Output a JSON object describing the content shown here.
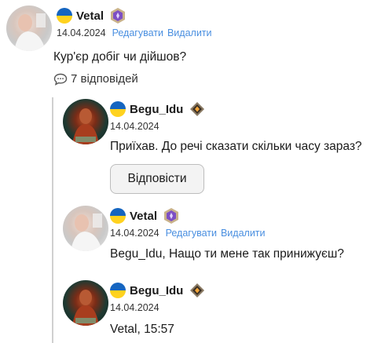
{
  "main_comment": {
    "username": "Vetal",
    "date": "14.04.2024",
    "edit_label": "Редагувати",
    "delete_label": "Видалити",
    "text": "Кур'єр добіг чи дійшов?",
    "replies_count": "7 відповідей"
  },
  "replies": [
    {
      "username": "Begu_Idu",
      "date": "14.04.2024",
      "text": "Приїхав. До речі сказати скільки часу зараз?",
      "reply_label": "Відповісти"
    },
    {
      "username": "Vetal",
      "date": "14.04.2024",
      "edit_label": "Редагувати",
      "delete_label": "Видалити",
      "mention": "Begu_Idu",
      "text": ", Нащо ти мене так принижуєш?"
    },
    {
      "username": "Begu_Idu",
      "date": "14.04.2024",
      "mention": "Vetal",
      "text": ", 15:57"
    }
  ],
  "colors": {
    "link": "#4a8fe0",
    "flag_blue": "#1565c0",
    "flag_yellow": "#ffd21f",
    "thread_line": "#d0d0d0"
  },
  "icons": {
    "flag": "ukraine-flag-icon",
    "badge_vetal": "purple-rank-badge-icon",
    "badge_begu": "bronze-rank-badge-icon",
    "replies": "speech-bubble-icon"
  }
}
